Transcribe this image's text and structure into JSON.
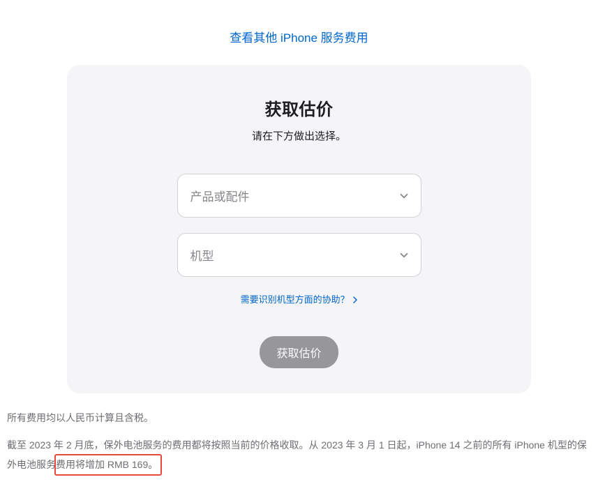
{
  "top_link": "查看其他 iPhone 服务费用",
  "card": {
    "title": "获取估价",
    "subtitle": "请在下方做出选择。",
    "select_product_placeholder": "产品或配件",
    "select_model_placeholder": "机型",
    "help_link": "需要识别机型方面的协助？",
    "button": "获取估价"
  },
  "footer": {
    "line1": "所有费用均以人民币计算且含税。",
    "line2_prefix": "截至 2023 年 2 月底，保外电池服务的费用都将按照当前的价格收取。从 2023 年 3 月 1 日起，iPhone 14 之前的所有 iPhone 机型的保外电池服务",
    "line2_highlight": "费用将增加 RMB 169。"
  }
}
